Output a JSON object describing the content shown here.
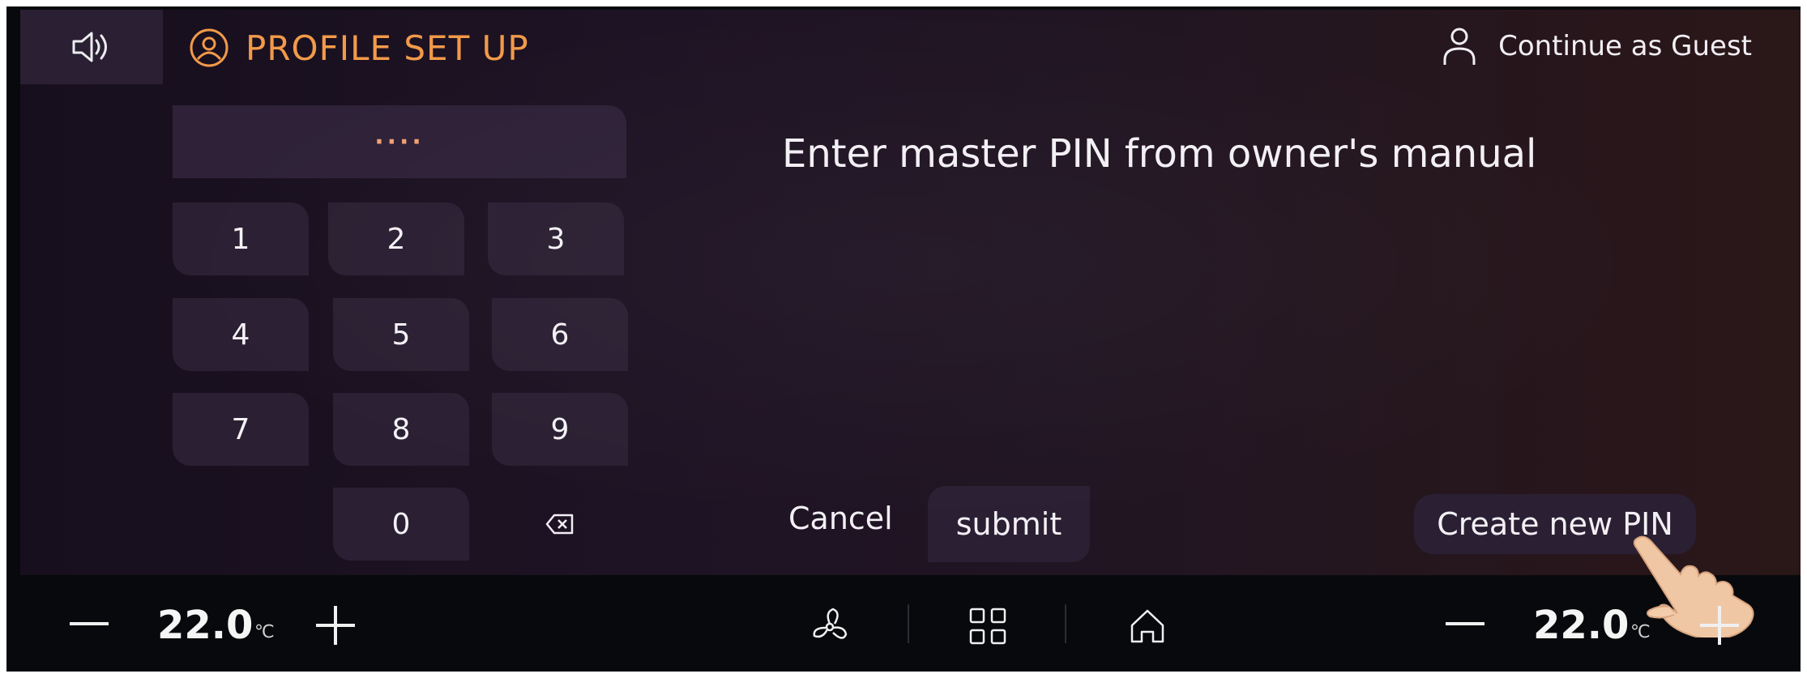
{
  "header": {
    "volume_icon": "speaker-icon",
    "profile_icon": "user-circle-icon",
    "title": "PROFILE SET UP",
    "guest_icon": "person-icon",
    "guest_label": "Continue as Guest"
  },
  "keypad": {
    "pin_display": "····",
    "keys": [
      "1",
      "2",
      "3",
      "4",
      "5",
      "6",
      "7",
      "8",
      "9",
      "0"
    ],
    "backspace_icon": "backspace-icon"
  },
  "main": {
    "prompt": "Enter master PIN from owner's manual",
    "cancel_label": "Cancel",
    "submit_label": "submit",
    "create_pin_label": "Create new PIN"
  },
  "climate_bar": {
    "left_temp": "22.0",
    "left_unit": "℃",
    "right_temp": "22.0",
    "right_unit": "℃",
    "icons": [
      "minus-icon",
      "plus-icon",
      "fan-icon",
      "apps-grid-icon",
      "home-icon"
    ]
  },
  "colors": {
    "accent": "#f29a4a",
    "key_bg": "#2b2033",
    "screen_bg": "#1e1324"
  }
}
